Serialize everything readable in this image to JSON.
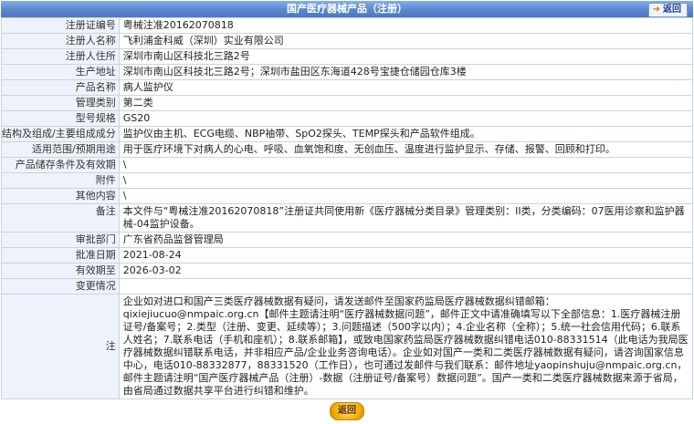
{
  "header": {
    "title": "国产医疗器械产品（注册）",
    "back_label": "返回"
  },
  "rows": [
    {
      "label": "注册证编号",
      "value": "粤械注准20162070818"
    },
    {
      "label": "注册人名称",
      "value": "飞利浦金科威（深圳）实业有限公司"
    },
    {
      "label": "注册人住所",
      "value": "深圳市南山区科技北三路2号"
    },
    {
      "label": "生产地址",
      "value": "深圳市南山区科技北三路2号；深圳市盐田区东海道428号宝捷仓储园仓库3楼"
    },
    {
      "label": "产品名称",
      "value": "病人监护仪"
    },
    {
      "label": "管理类别",
      "value": "第二类"
    },
    {
      "label": "型号规格",
      "value": "GS20"
    },
    {
      "label": "结构及组成/主要组成成分",
      "value": "监护仪由主机、ECG电缆、NBP袖带、SpO2探头、TEMP探头和产品软件组成。"
    },
    {
      "label": "适用范围/预期用途",
      "value": "用于医疗环境下对病人的心电、呼吸、血氧饱和度、无创血压、温度进行监护显示、存储、报警、回顾和打印。"
    },
    {
      "label": "产品储存条件及有效期",
      "value": "\\"
    },
    {
      "label": "附件",
      "value": "\\"
    },
    {
      "label": "其他内容",
      "value": "\\"
    },
    {
      "label": "备注",
      "value": "本文件与“粤械注准20162070818”注册证共同使用新《医疗器械分类目录》管理类别：II类，分类编码：07医用诊察和监护器械-04监护设备。"
    },
    {
      "label": "审批部门",
      "value": "广东省药品监督管理局"
    },
    {
      "label": "批准日期",
      "value": "2021-08-24"
    },
    {
      "label": "有效期至",
      "value": "2026-03-02"
    },
    {
      "label": "变更情况",
      "value": ""
    }
  ],
  "note": {
    "label": "注",
    "text": "企业如对进口和国产三类医疗器械数据有疑问，请发送邮件至国家药监局医疗器械数据纠错邮箱：qixiejiucuo@nmpaic.org.cn【邮件主题请注明“医疗器械数据问题”，邮件正文中请准确填写以下全部信息：1.医疗器械注册证号/备案号；2.类型（注册、变更、延续等）；3.问题描述（500字以内）；4.企业名称（全称）；5.统一社会信用代码；6.联系人姓名；7.联系电话（手机和座机）；8.联系邮箱】，或致电国家药监局医疗器械数据纠错电话010-88331514（此电话为我局医疗器械数据纠错联系电话，并非相应产品/企业业务咨询电话）。企业如对国产一类和二类医疗器械数据有疑问，请咨询国家信息中心，电话010-88332877，88331520（工作日），也可通过发邮件与我们联系：邮件地址yaopinshuju@nmpaic.org.cn，邮件主题请注明“国产医疗器械产品（注册）-数据（注册证号/备案号）数据问题”。国产一类和二类医疗器械数据来源于省局，由省局通过数据共享平台进行纠错和维护。"
  },
  "footer": {
    "back_label": "返回"
  }
}
